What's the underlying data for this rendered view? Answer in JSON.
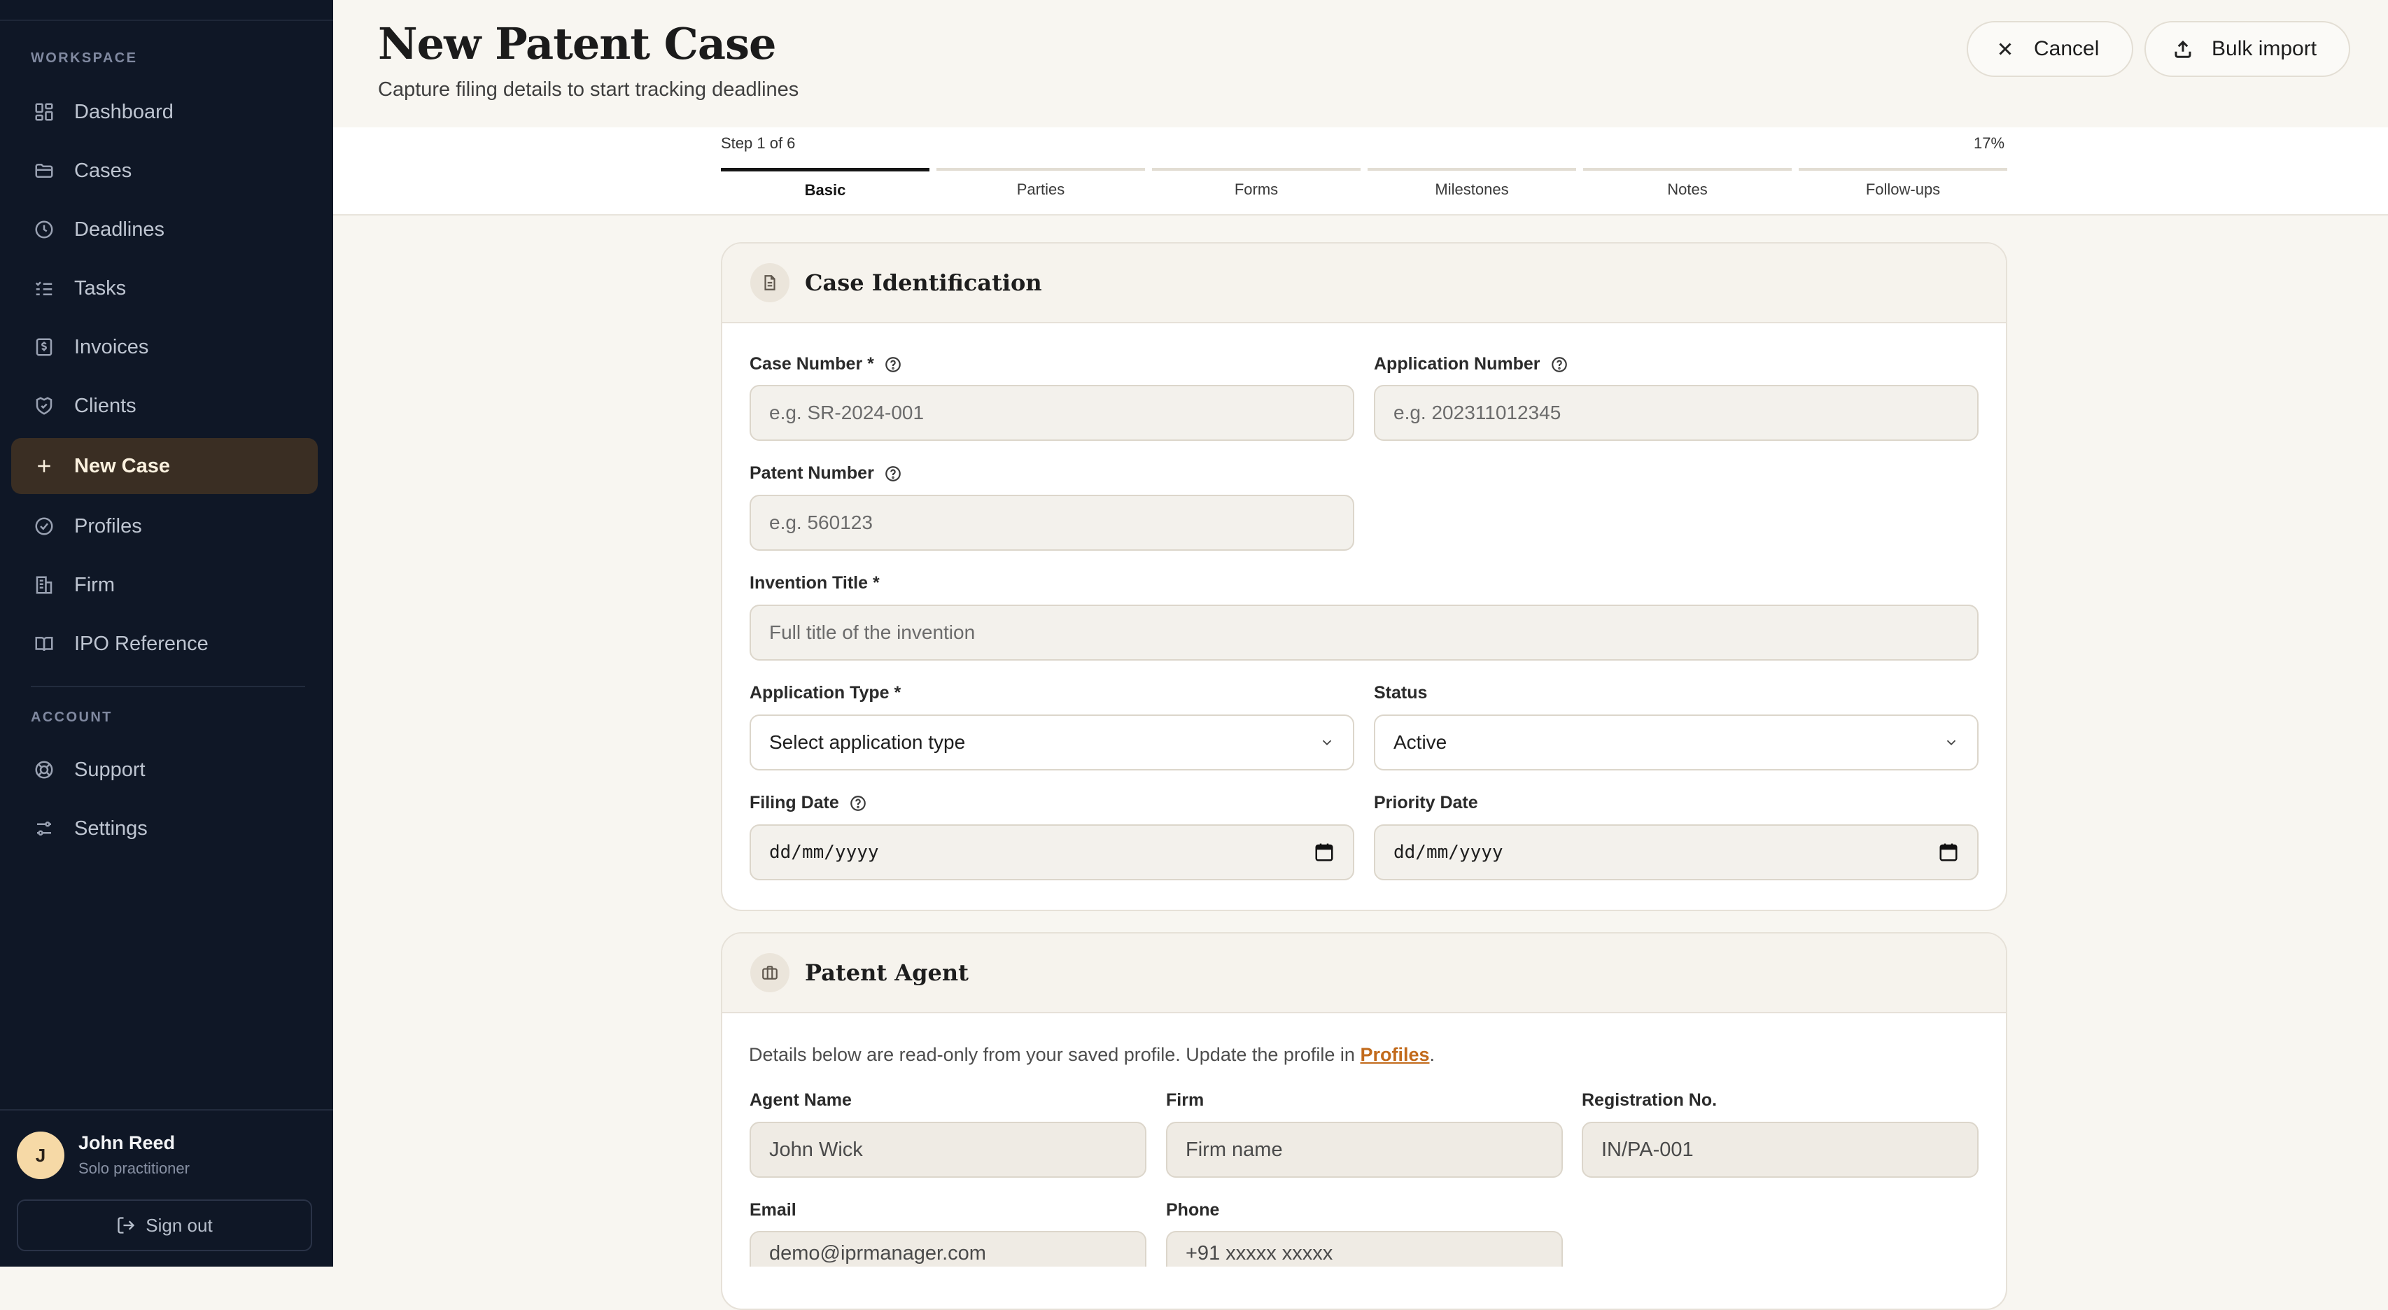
{
  "sidebar": {
    "workspace_label": "WORKSPACE",
    "account_label": "ACCOUNT",
    "items": [
      {
        "label": "Dashboard",
        "icon": "grid-icon"
      },
      {
        "label": "Cases",
        "icon": "folder-icon"
      },
      {
        "label": "Deadlines",
        "icon": "clock-icon"
      },
      {
        "label": "Tasks",
        "icon": "checklist-icon"
      },
      {
        "label": "Invoices",
        "icon": "invoice-icon"
      },
      {
        "label": "Clients",
        "icon": "handshake-icon"
      },
      {
        "label": "New Case",
        "icon": "plus-icon"
      },
      {
        "label": "Profiles",
        "icon": "badge-check-icon"
      },
      {
        "label": "Firm",
        "icon": "building-icon"
      },
      {
        "label": "IPO Reference",
        "icon": "book-icon"
      }
    ],
    "account_items": [
      {
        "label": "Support",
        "icon": "lifebuoy-icon"
      },
      {
        "label": "Settings",
        "icon": "sliders-icon"
      }
    ],
    "user": {
      "initial": "J",
      "name": "John Reed",
      "role": "Solo practitioner"
    },
    "signout_label": "Sign out"
  },
  "header": {
    "title": "New Patent Case",
    "subtitle": "Capture filing details to start tracking deadlines",
    "cancel_label": "Cancel",
    "bulk_import_label": "Bulk import"
  },
  "stepper": {
    "step_text": "Step 1 of 6",
    "percent_text": "17%",
    "progress": 0.17,
    "steps": [
      "Basic",
      "Parties",
      "Forms",
      "Milestones",
      "Notes",
      "Follow-ups"
    ],
    "active_index": 0
  },
  "case_identification": {
    "title": "Case Identification",
    "case_number_label": "Case Number *",
    "case_number_placeholder": "e.g. SR-2024-001",
    "application_number_label": "Application Number",
    "application_number_placeholder": "e.g. 202311012345",
    "patent_number_label": "Patent Number",
    "patent_number_placeholder": "e.g. 560123",
    "invention_title_label": "Invention Title *",
    "invention_title_placeholder": "Full title of the invention",
    "application_type_label": "Application Type *",
    "application_type_value": "Select application type",
    "status_label": "Status",
    "status_value": "Active",
    "filing_date_label": "Filing Date",
    "filing_date_value": "dd/mm/yyyy",
    "priority_date_label": "Priority Date",
    "priority_date_value": "dd/mm/yyyy"
  },
  "patent_agent": {
    "title": "Patent Agent",
    "note_text": "Details below are read-only from your saved profile. Update the profile in ",
    "note_link": "Profiles",
    "note_end": ".",
    "agent_name_label": "Agent Name",
    "agent_name_value": "John Wick",
    "firm_label": "Firm",
    "firm_value": "Firm name",
    "registration_label": "Registration No.",
    "registration_value": "IN/PA-001",
    "email_label": "Email",
    "email_value": "demo@iprmanager.com",
    "phone_label": "Phone",
    "phone_value": "+91 xxxxx xxxxx"
  },
  "colors": {
    "sidebar_bg": "#0f1726",
    "active_item_bg": "#3a2e23",
    "page_bg": "#f8f6f1",
    "link": "#c26a1b"
  }
}
